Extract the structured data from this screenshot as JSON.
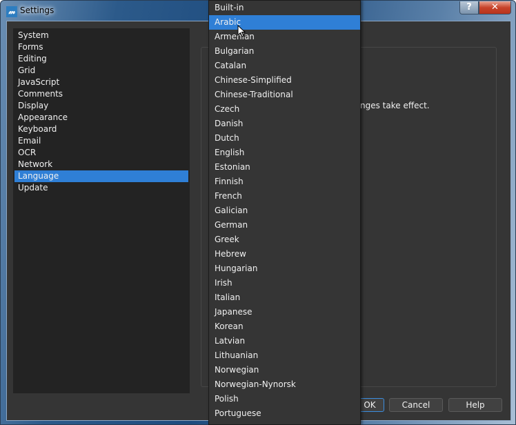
{
  "window": {
    "title": "Settings",
    "help_label": "?",
    "close_label": "✕",
    "app_icon": "M"
  },
  "sidebar": {
    "items": [
      "System",
      "Forms",
      "Editing",
      "Grid",
      "JavaScript",
      "Comments",
      "Display",
      "Appearance",
      "Keyboard",
      "Email",
      "OCR",
      "Network",
      "Language",
      "Update"
    ],
    "selected": "Language"
  },
  "main": {
    "message_visible": "nges take effect."
  },
  "buttons": {
    "ok": "OK",
    "cancel": "Cancel",
    "help": "Help"
  },
  "dropdown": {
    "options": [
      "Built-in",
      "Arabic",
      "Armenian",
      "Bulgarian",
      "Catalan",
      "Chinese-Simplified",
      "Chinese-Traditional",
      "Czech",
      "Danish",
      "Dutch",
      "English",
      "Estonian",
      "Finnish",
      "French",
      "Galician",
      "German",
      "Greek",
      "Hebrew",
      "Hungarian",
      "Irish",
      "Italian",
      "Japanese",
      "Korean",
      "Latvian",
      "Lithuanian",
      "Norwegian",
      "Norwegian-Nynorsk",
      "Polish",
      "Portuguese"
    ],
    "highlighted": "Arabic"
  },
  "colors": {
    "accent": "#2f7fd6",
    "background": "#353535",
    "list_bg": "#232323"
  }
}
